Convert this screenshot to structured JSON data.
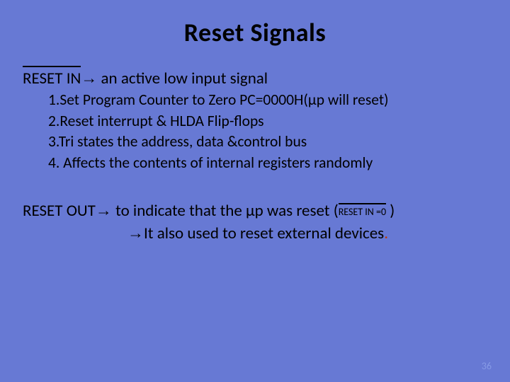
{
  "title": "Reset Signals",
  "reset_in": {
    "label": "RESET IN",
    "rest": " an active low input signal"
  },
  "items": [
    "1.Set Program Counter to Zero PC=0000H(µp will reset)",
    "2.Reset interrupt & HLDA Flip-flops",
    "3.Tri states the address, data &control bus",
    "4. Affects the contents of internal registers randomly"
  ],
  "reset_out": {
    "label": "RESET OUT",
    "rest_a": " to indicate that the µp was reset (",
    "cond": " RESET IN =0 ",
    "rest_b": " )"
  },
  "line2": "It also used to reset external devices",
  "dot": ".",
  "arrow": "→",
  "page": "36"
}
